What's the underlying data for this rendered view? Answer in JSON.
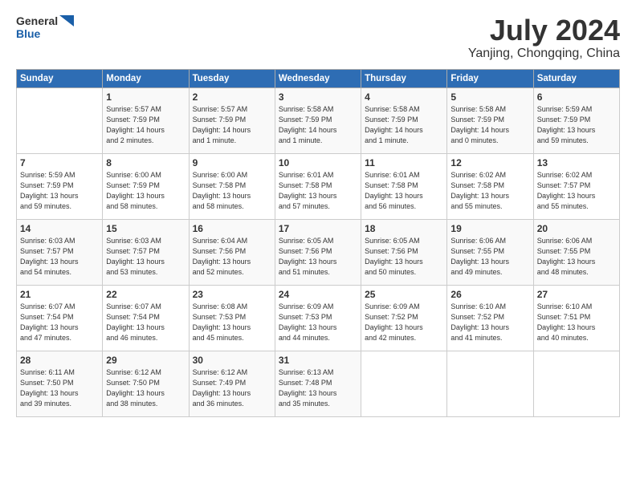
{
  "header": {
    "logo_line1": "General",
    "logo_line2": "Blue",
    "month_year": "July 2024",
    "location": "Yanjing, Chongqing, China"
  },
  "days_of_week": [
    "Sunday",
    "Monday",
    "Tuesday",
    "Wednesday",
    "Thursday",
    "Friday",
    "Saturday"
  ],
  "weeks": [
    [
      {
        "day": "",
        "info": ""
      },
      {
        "day": "1",
        "info": "Sunrise: 5:57 AM\nSunset: 7:59 PM\nDaylight: 14 hours\nand 2 minutes."
      },
      {
        "day": "2",
        "info": "Sunrise: 5:57 AM\nSunset: 7:59 PM\nDaylight: 14 hours\nand 1 minute."
      },
      {
        "day": "3",
        "info": "Sunrise: 5:58 AM\nSunset: 7:59 PM\nDaylight: 14 hours\nand 1 minute."
      },
      {
        "day": "4",
        "info": "Sunrise: 5:58 AM\nSunset: 7:59 PM\nDaylight: 14 hours\nand 1 minute."
      },
      {
        "day": "5",
        "info": "Sunrise: 5:58 AM\nSunset: 7:59 PM\nDaylight: 14 hours\nand 0 minutes."
      },
      {
        "day": "6",
        "info": "Sunrise: 5:59 AM\nSunset: 7:59 PM\nDaylight: 13 hours\nand 59 minutes."
      }
    ],
    [
      {
        "day": "7",
        "info": "Sunrise: 5:59 AM\nSunset: 7:59 PM\nDaylight: 13 hours\nand 59 minutes."
      },
      {
        "day": "8",
        "info": "Sunrise: 6:00 AM\nSunset: 7:59 PM\nDaylight: 13 hours\nand 58 minutes."
      },
      {
        "day": "9",
        "info": "Sunrise: 6:00 AM\nSunset: 7:58 PM\nDaylight: 13 hours\nand 58 minutes."
      },
      {
        "day": "10",
        "info": "Sunrise: 6:01 AM\nSunset: 7:58 PM\nDaylight: 13 hours\nand 57 minutes."
      },
      {
        "day": "11",
        "info": "Sunrise: 6:01 AM\nSunset: 7:58 PM\nDaylight: 13 hours\nand 56 minutes."
      },
      {
        "day": "12",
        "info": "Sunrise: 6:02 AM\nSunset: 7:58 PM\nDaylight: 13 hours\nand 55 minutes."
      },
      {
        "day": "13",
        "info": "Sunrise: 6:02 AM\nSunset: 7:57 PM\nDaylight: 13 hours\nand 55 minutes."
      }
    ],
    [
      {
        "day": "14",
        "info": "Sunrise: 6:03 AM\nSunset: 7:57 PM\nDaylight: 13 hours\nand 54 minutes."
      },
      {
        "day": "15",
        "info": "Sunrise: 6:03 AM\nSunset: 7:57 PM\nDaylight: 13 hours\nand 53 minutes."
      },
      {
        "day": "16",
        "info": "Sunrise: 6:04 AM\nSunset: 7:56 PM\nDaylight: 13 hours\nand 52 minutes."
      },
      {
        "day": "17",
        "info": "Sunrise: 6:05 AM\nSunset: 7:56 PM\nDaylight: 13 hours\nand 51 minutes."
      },
      {
        "day": "18",
        "info": "Sunrise: 6:05 AM\nSunset: 7:56 PM\nDaylight: 13 hours\nand 50 minutes."
      },
      {
        "day": "19",
        "info": "Sunrise: 6:06 AM\nSunset: 7:55 PM\nDaylight: 13 hours\nand 49 minutes."
      },
      {
        "day": "20",
        "info": "Sunrise: 6:06 AM\nSunset: 7:55 PM\nDaylight: 13 hours\nand 48 minutes."
      }
    ],
    [
      {
        "day": "21",
        "info": "Sunrise: 6:07 AM\nSunset: 7:54 PM\nDaylight: 13 hours\nand 47 minutes."
      },
      {
        "day": "22",
        "info": "Sunrise: 6:07 AM\nSunset: 7:54 PM\nDaylight: 13 hours\nand 46 minutes."
      },
      {
        "day": "23",
        "info": "Sunrise: 6:08 AM\nSunset: 7:53 PM\nDaylight: 13 hours\nand 45 minutes."
      },
      {
        "day": "24",
        "info": "Sunrise: 6:09 AM\nSunset: 7:53 PM\nDaylight: 13 hours\nand 44 minutes."
      },
      {
        "day": "25",
        "info": "Sunrise: 6:09 AM\nSunset: 7:52 PM\nDaylight: 13 hours\nand 42 minutes."
      },
      {
        "day": "26",
        "info": "Sunrise: 6:10 AM\nSunset: 7:52 PM\nDaylight: 13 hours\nand 41 minutes."
      },
      {
        "day": "27",
        "info": "Sunrise: 6:10 AM\nSunset: 7:51 PM\nDaylight: 13 hours\nand 40 minutes."
      }
    ],
    [
      {
        "day": "28",
        "info": "Sunrise: 6:11 AM\nSunset: 7:50 PM\nDaylight: 13 hours\nand 39 minutes."
      },
      {
        "day": "29",
        "info": "Sunrise: 6:12 AM\nSunset: 7:50 PM\nDaylight: 13 hours\nand 38 minutes."
      },
      {
        "day": "30",
        "info": "Sunrise: 6:12 AM\nSunset: 7:49 PM\nDaylight: 13 hours\nand 36 minutes."
      },
      {
        "day": "31",
        "info": "Sunrise: 6:13 AM\nSunset: 7:48 PM\nDaylight: 13 hours\nand 35 minutes."
      },
      {
        "day": "",
        "info": ""
      },
      {
        "day": "",
        "info": ""
      },
      {
        "day": "",
        "info": ""
      }
    ]
  ]
}
